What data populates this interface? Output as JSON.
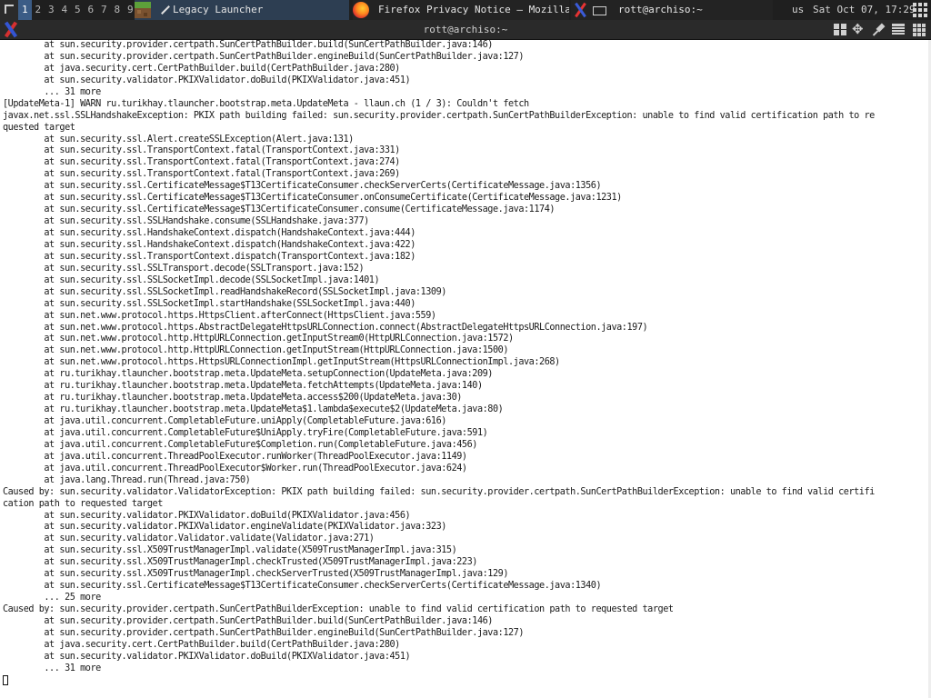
{
  "panel": {
    "workspaces": [
      "1",
      "2",
      "3",
      "4",
      "5",
      "6",
      "7",
      "8",
      "9"
    ],
    "active_workspace": "1",
    "tasks": [
      {
        "label": "Legacy Launcher",
        "icon": "minecraft-grass-block-icon"
      },
      {
        "label": "Firefox Privacy Notice — Mozilla",
        "icon": "firefox-icon"
      },
      {
        "label": "rott@archiso:~",
        "icon": "xterm-icon"
      }
    ],
    "keyboard_layout": "us",
    "clock": "Sat Oct 07, 17:29"
  },
  "window": {
    "title": "rott@archiso:~"
  },
  "terminal": {
    "lines": [
      "        at sun.security.provider.certpath.SunCertPathBuilder.build(SunCertPathBuilder.java:146)",
      "        at sun.security.provider.certpath.SunCertPathBuilder.engineBuild(SunCertPathBuilder.java:127)",
      "        at java.security.cert.CertPathBuilder.build(CertPathBuilder.java:280)",
      "        at sun.security.validator.PKIXValidator.doBuild(PKIXValidator.java:451)",
      "        ... 31 more",
      "[UpdateMeta-1] WARN ru.turikhay.tlauncher.bootstrap.meta.UpdateMeta - llaun.ch (1 / 3): Couldn't fetch",
      "javax.net.ssl.SSLHandshakeException: PKIX path building failed: sun.security.provider.certpath.SunCertPathBuilderException: unable to find valid certification path to re",
      "quested target",
      "        at sun.security.ssl.Alert.createSSLException(Alert.java:131)",
      "        at sun.security.ssl.TransportContext.fatal(TransportContext.java:331)",
      "        at sun.security.ssl.TransportContext.fatal(TransportContext.java:274)",
      "        at sun.security.ssl.TransportContext.fatal(TransportContext.java:269)",
      "        at sun.security.ssl.CertificateMessage$T13CertificateConsumer.checkServerCerts(CertificateMessage.java:1356)",
      "        at sun.security.ssl.CertificateMessage$T13CertificateConsumer.onConsumeCertificate(CertificateMessage.java:1231)",
      "        at sun.security.ssl.CertificateMessage$T13CertificateConsumer.consume(CertificateMessage.java:1174)",
      "        at sun.security.ssl.SSLHandshake.consume(SSLHandshake.java:377)",
      "        at sun.security.ssl.HandshakeContext.dispatch(HandshakeContext.java:444)",
      "        at sun.security.ssl.HandshakeContext.dispatch(HandshakeContext.java:422)",
      "        at sun.security.ssl.TransportContext.dispatch(TransportContext.java:182)",
      "        at sun.security.ssl.SSLTransport.decode(SSLTransport.java:152)",
      "        at sun.security.ssl.SSLSocketImpl.decode(SSLSocketImpl.java:1401)",
      "        at sun.security.ssl.SSLSocketImpl.readHandshakeRecord(SSLSocketImpl.java:1309)",
      "        at sun.security.ssl.SSLSocketImpl.startHandshake(SSLSocketImpl.java:440)",
      "        at sun.net.www.protocol.https.HttpsClient.afterConnect(HttpsClient.java:559)",
      "        at sun.net.www.protocol.https.AbstractDelegateHttpsURLConnection.connect(AbstractDelegateHttpsURLConnection.java:197)",
      "        at sun.net.www.protocol.http.HttpURLConnection.getInputStream0(HttpURLConnection.java:1572)",
      "        at sun.net.www.protocol.http.HttpURLConnection.getInputStream(HttpURLConnection.java:1500)",
      "        at sun.net.www.protocol.https.HttpsURLConnectionImpl.getInputStream(HttpsURLConnectionImpl.java:268)",
      "        at ru.turikhay.tlauncher.bootstrap.meta.UpdateMeta.setupConnection(UpdateMeta.java:209)",
      "        at ru.turikhay.tlauncher.bootstrap.meta.UpdateMeta.fetchAttempts(UpdateMeta.java:140)",
      "        at ru.turikhay.tlauncher.bootstrap.meta.UpdateMeta.access$200(UpdateMeta.java:30)",
      "        at ru.turikhay.tlauncher.bootstrap.meta.UpdateMeta$1.lambda$execute$2(UpdateMeta.java:80)",
      "        at java.util.concurrent.CompletableFuture.uniApply(CompletableFuture.java:616)",
      "        at java.util.concurrent.CompletableFuture$UniApply.tryFire(CompletableFuture.java:591)",
      "        at java.util.concurrent.CompletableFuture$Completion.run(CompletableFuture.java:456)",
      "        at java.util.concurrent.ThreadPoolExecutor.runWorker(ThreadPoolExecutor.java:1149)",
      "        at java.util.concurrent.ThreadPoolExecutor$Worker.run(ThreadPoolExecutor.java:624)",
      "        at java.lang.Thread.run(Thread.java:750)",
      "Caused by: sun.security.validator.ValidatorException: PKIX path building failed: sun.security.provider.certpath.SunCertPathBuilderException: unable to find valid certifi",
      "cation path to requested target",
      "        at sun.security.validator.PKIXValidator.doBuild(PKIXValidator.java:456)",
      "        at sun.security.validator.PKIXValidator.engineValidate(PKIXValidator.java:323)",
      "        at sun.security.validator.Validator.validate(Validator.java:271)",
      "        at sun.security.ssl.X509TrustManagerImpl.validate(X509TrustManagerImpl.java:315)",
      "        at sun.security.ssl.X509TrustManagerImpl.checkTrusted(X509TrustManagerImpl.java:223)",
      "        at sun.security.ssl.X509TrustManagerImpl.checkServerTrusted(X509TrustManagerImpl.java:129)",
      "        at sun.security.ssl.CertificateMessage$T13CertificateConsumer.checkServerCerts(CertificateMessage.java:1340)",
      "        ... 25 more",
      "Caused by: sun.security.provider.certpath.SunCertPathBuilderException: unable to find valid certification path to requested target",
      "        at sun.security.provider.certpath.SunCertPathBuilder.build(SunCertPathBuilder.java:146)",
      "        at sun.security.provider.certpath.SunCertPathBuilder.engineBuild(SunCertPathBuilder.java:127)",
      "        at java.security.cert.CertPathBuilder.build(CertPathBuilder.java:280)",
      "        at sun.security.validator.PKIXValidator.doBuild(PKIXValidator.java:451)",
      "        ... 31 more"
    ]
  }
}
